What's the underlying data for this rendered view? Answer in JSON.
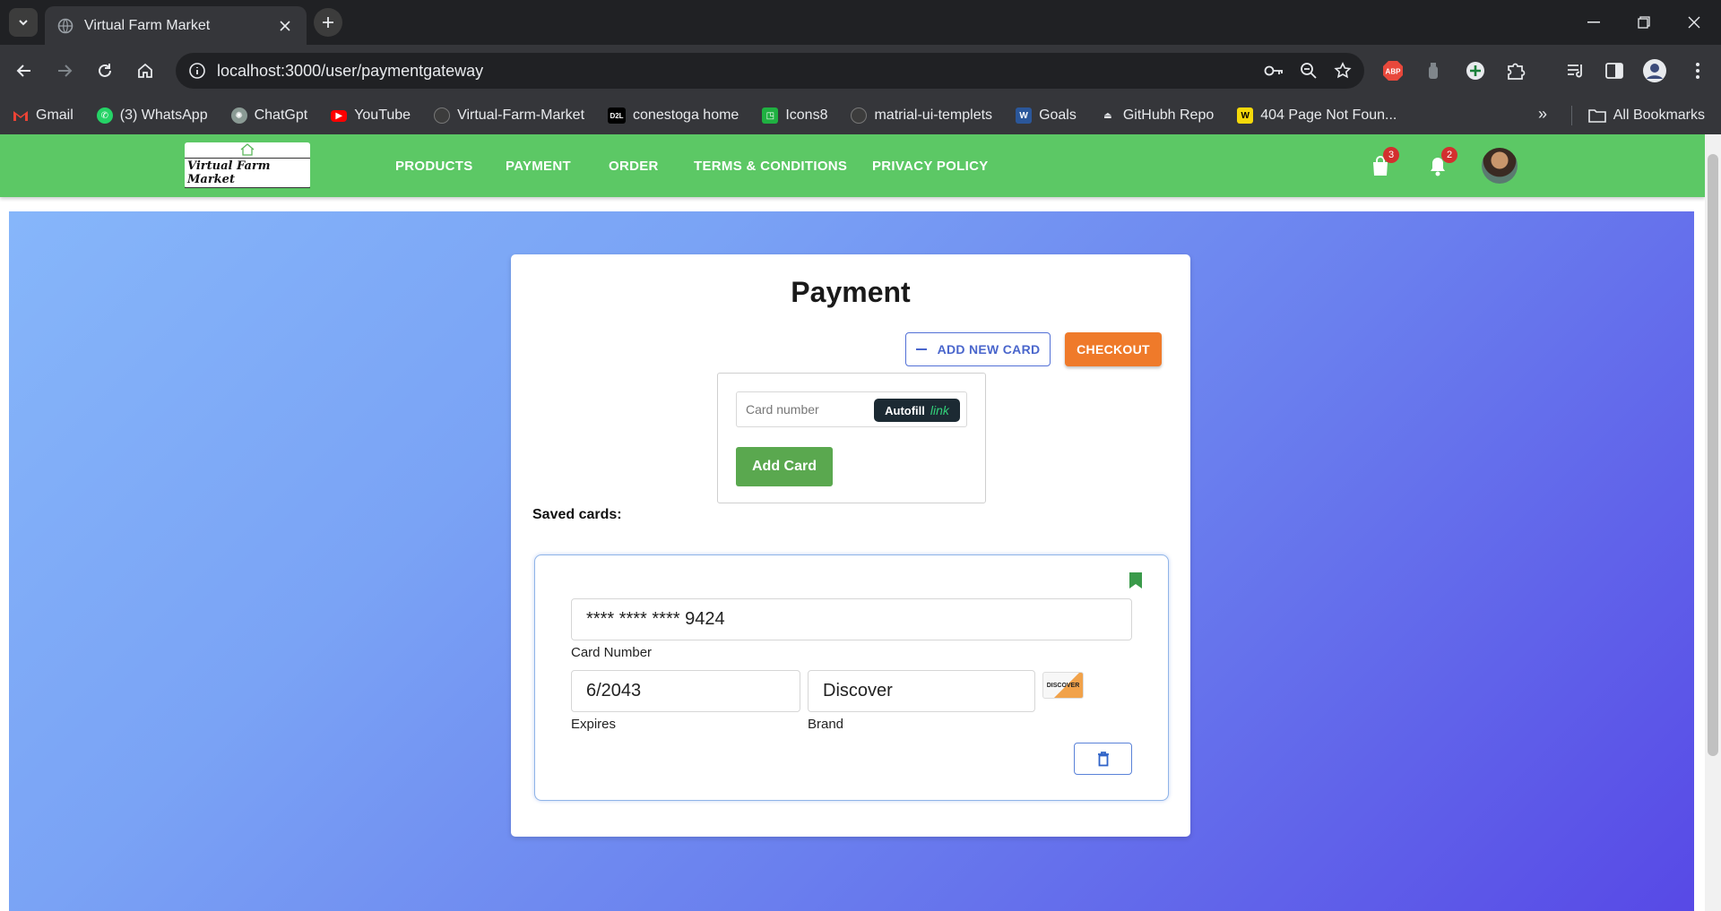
{
  "browser": {
    "tab_title": "Virtual Farm Market",
    "url": "localhost:3000/user/paymentgateway",
    "bookmarks": [
      {
        "label": "Gmail",
        "icon": "gmail-icon"
      },
      {
        "label": "(3) WhatsApp",
        "icon": "whatsapp-icon"
      },
      {
        "label": "ChatGpt",
        "icon": "chatgpt-icon"
      },
      {
        "label": "YouTube",
        "icon": "youtube-icon"
      },
      {
        "label": "Virtual-Farm-Market",
        "icon": "github-icon"
      },
      {
        "label": "conestoga home",
        "icon": "d2l-icon"
      },
      {
        "label": "Icons8",
        "icon": "icons8-icon"
      },
      {
        "label": "matrial-ui-templets",
        "icon": "github-icon"
      },
      {
        "label": "Goals",
        "icon": "word-icon"
      },
      {
        "label": "GitHubh Repo",
        "icon": "repo-icon"
      },
      {
        "label": "404 Page Not Foun...",
        "icon": "w-icon"
      }
    ],
    "all_bookmarks": "All Bookmarks",
    "extension_badge": "ABP"
  },
  "app": {
    "logo_text": "Virtual Farm Market",
    "nav": [
      "PRODUCTS",
      "PAYMENT",
      "ORDER",
      "TERMS & CONDITIONS",
      "PRIVACY POLICY"
    ],
    "cart_count": "3",
    "notification_count": "2"
  },
  "payment": {
    "title": "Payment",
    "add_new_card": "ADD NEW CARD",
    "checkout": "CHECKOUT",
    "card_number_placeholder": "Card number",
    "autofill": "Autofill",
    "autofill_link": "link",
    "add_card": "Add Card",
    "saved_cards_label": "Saved cards:",
    "saved_card": {
      "number": "**** **** **** 9424",
      "number_label": "Card Number",
      "expires": "6/2043",
      "expires_label": "Expires",
      "brand": "Discover",
      "brand_label": "Brand",
      "brand_logo_text": "DISCOVER"
    }
  },
  "colors": {
    "appbar": "#5cc865",
    "checkout": "#ef7a2a",
    "add_card": "#5aa84f",
    "accent_blue": "#4a66cc"
  }
}
